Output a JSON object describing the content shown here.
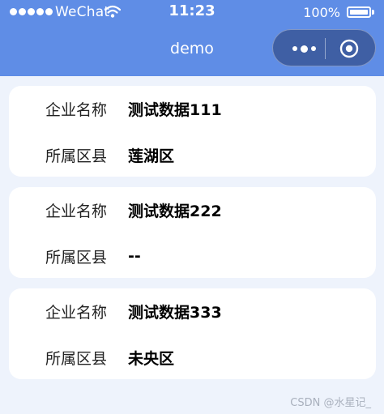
{
  "status_bar": {
    "carrier": "WeChat",
    "time": "11:23",
    "battery": "100%",
    "battery_level": 1.0
  },
  "nav": {
    "title": "demo"
  },
  "cards": [
    {
      "name_label": "企业名称",
      "name_value": "测试数据111",
      "district_label": "所属区县",
      "district_value": "莲湖区"
    },
    {
      "name_label": "企业名称",
      "name_value": "测试数据222",
      "district_label": "所属区县",
      "district_value": "--"
    },
    {
      "name_label": "企业名称",
      "name_value": "测试数据333",
      "district_label": "所属区县",
      "district_value": "未央区"
    }
  ],
  "watermark": "CSDN @水星记_",
  "icons": {
    "signal": "signal-dots-icon",
    "wifi": "wifi-icon",
    "battery": "battery-icon",
    "more": "more-dots-icon",
    "close": "close-circle-icon"
  },
  "colors": {
    "nav_background": "#5f8de6",
    "page_background": "#eef3fc",
    "card_background": "#ffffff",
    "capsule_background": "#3f5fa4"
  }
}
